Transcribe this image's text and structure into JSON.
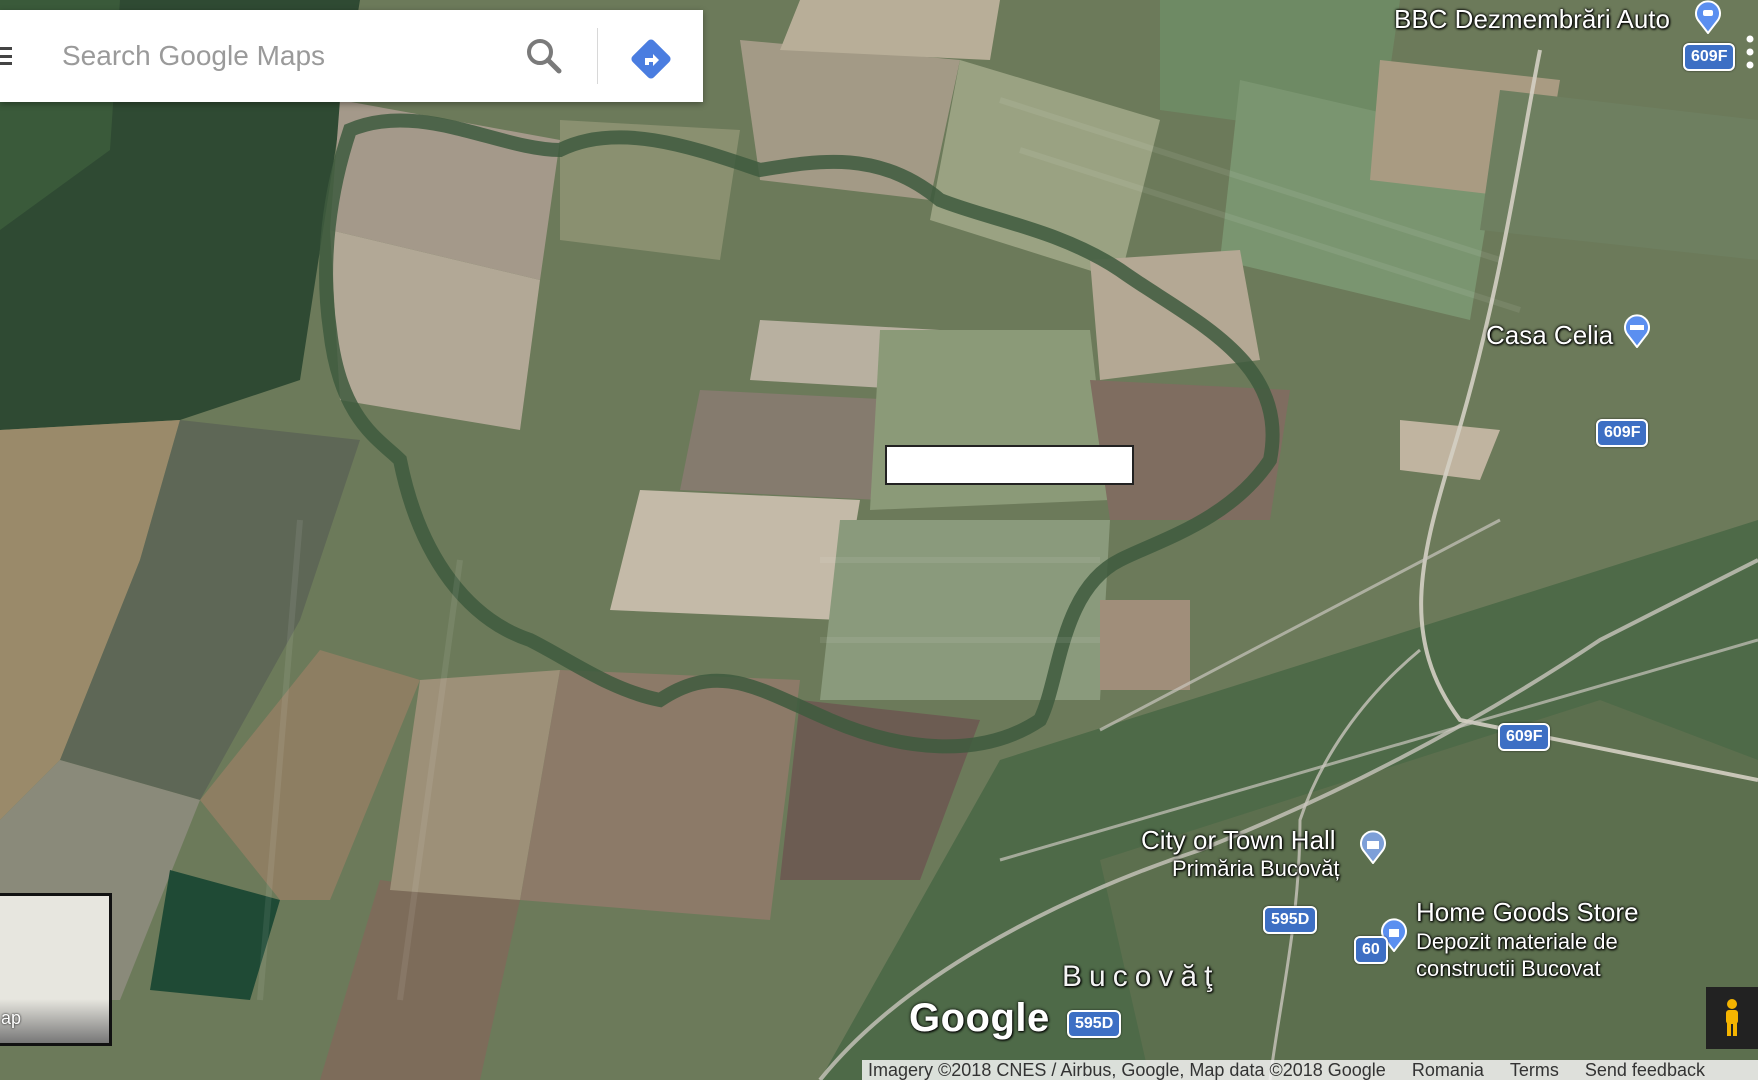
{
  "search": {
    "placeholder": "Search Google Maps"
  },
  "places": {
    "bbc": "BBC Dezmembrări Auto",
    "casa_celia": "Casa Celia",
    "town_hall_category": "City or Town Hall",
    "town_hall_name": "Primăria Bucovăț",
    "home_goods_category": "Home Goods Store",
    "home_goods_line1": "Depozit materiale de",
    "home_goods_line2": "constructii Bucovat"
  },
  "town": "Bucovăţ",
  "road_shields": {
    "r1": "609F",
    "r2": "609F",
    "r3": "609F",
    "r4": "595D",
    "r5": "60",
    "r6": "595D"
  },
  "logo": "Google",
  "minimap_label": "ap",
  "attribution": {
    "imagery": "Imagery ©2018 CNES / Airbus, Google, Map data ©2018 Google",
    "country": "Romania",
    "terms": "Terms",
    "feedback": "Send feedback"
  },
  "colors": {
    "shield_blue": "#3d6fc4",
    "directions_blue": "#4a7de0",
    "pin_blue": "#5b8ff0"
  },
  "icons": {
    "search": "search-icon",
    "directions": "directions-icon",
    "menu": "menu-icon",
    "pegman": "pegman-icon",
    "pin_car": "car-pin-icon",
    "pin_hotel": "hotel-pin-icon",
    "pin_townhall": "townhall-pin-icon",
    "pin_store": "store-pin-icon"
  }
}
